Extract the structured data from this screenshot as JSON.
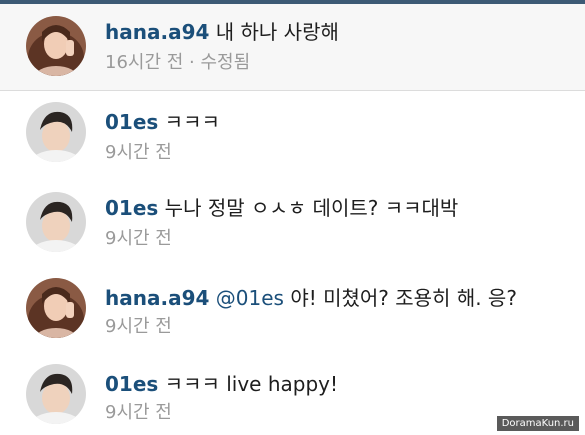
{
  "colors": {
    "username": "#1b4f7a",
    "text": "#1e1e1e",
    "meta": "#9a9a9a",
    "topbar": "#3d5a75"
  },
  "caption": {
    "username": "hana.a94",
    "text": "내 하나 사랑해",
    "meta": "16시간 전 · 수정됨"
  },
  "comments": [
    {
      "username": "01es",
      "mention": "",
      "text": "ㅋㅋㅋ",
      "time": "9시간 전"
    },
    {
      "username": "01es",
      "mention": "",
      "text": "누나 정말 ㅇㅅㅎ 데이트? ㅋㅋ대박",
      "time": "9시간 전"
    },
    {
      "username": "hana.a94",
      "mention": "@01es",
      "text": "야! 미쳤어? 조용히 해. 응?",
      "time": "9시간 전"
    },
    {
      "username": "01es",
      "mention": "",
      "text": "ㅋㅋㅋ live happy!",
      "time": "9시간 전"
    }
  ],
  "watermark": "DoramaKun.ru"
}
